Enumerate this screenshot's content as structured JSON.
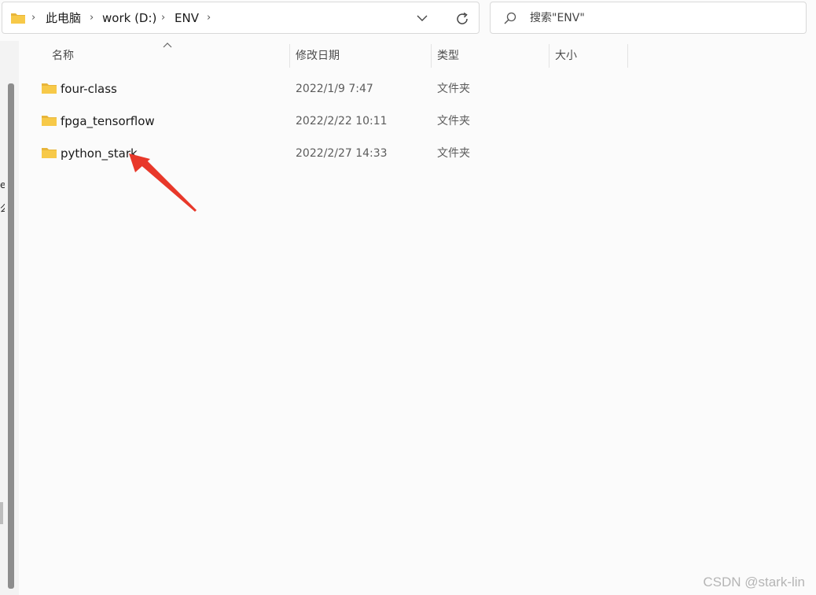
{
  "address_bar": {
    "breadcrumbs": [
      "此电脑",
      "work (D:)",
      "ENV"
    ]
  },
  "search": {
    "placeholder": "搜索\"ENV\""
  },
  "columns": {
    "name": "名称",
    "modified": "修改日期",
    "type": "类型",
    "size": "大小"
  },
  "files": [
    {
      "name": "four-class",
      "modified": "2022/1/9 7:47",
      "type": "文件夹",
      "size": ""
    },
    {
      "name": "fpga_tensorflow",
      "modified": "2022/2/22 10:11",
      "type": "文件夹",
      "size": ""
    },
    {
      "name": "python_stark",
      "modified": "2022/2/27 14:33",
      "type": "文件夹",
      "size": ""
    }
  ],
  "nav_pane_clipped": [
    "e",
    "么"
  ],
  "watermark": "CSDN @stark-lin",
  "colors": {
    "folder": "#f7c948",
    "annotation_arrow": "#e8382a"
  }
}
